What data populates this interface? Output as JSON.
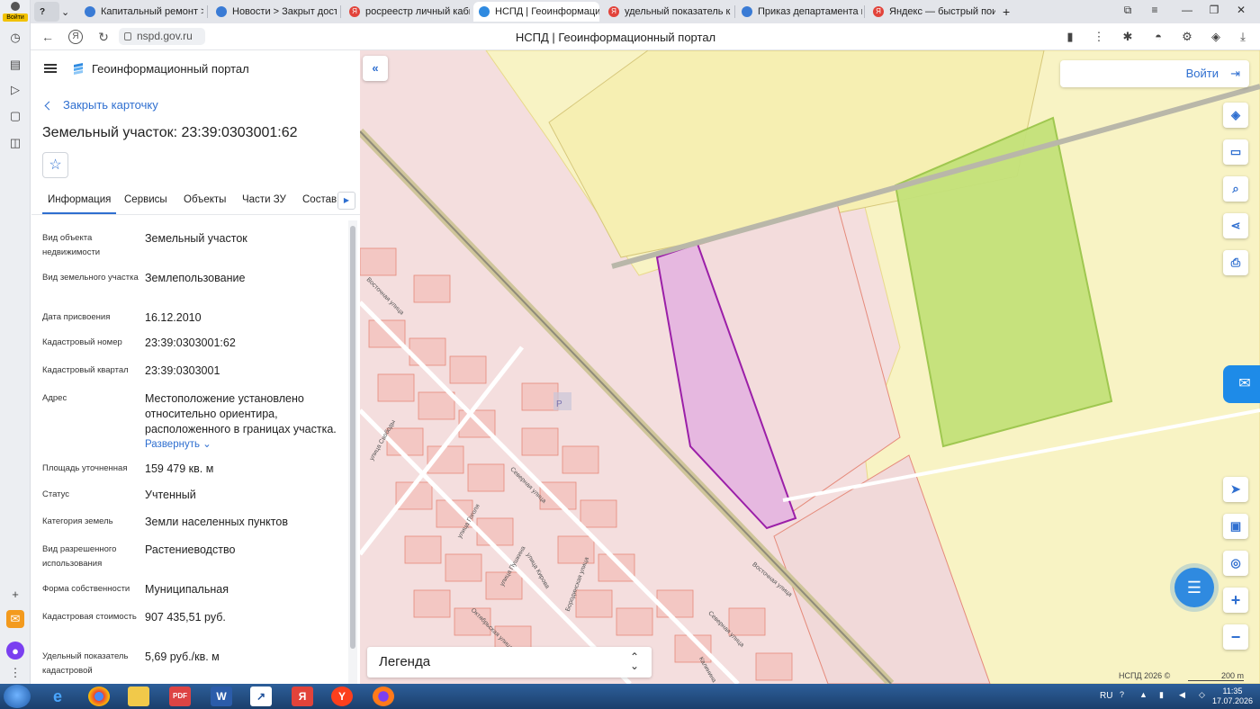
{
  "browser": {
    "user_badge": "Войти",
    "tabs": [
      {
        "label": "Капитальный ремонт > Г",
        "icon_color": "#3a7bd5"
      },
      {
        "label": "Новости > Закрыт доступ",
        "icon_color": "#3a7bd5"
      },
      {
        "label": "росреестр личный кабин",
        "icon_color": "#e2433a"
      },
      {
        "label": "НСПД | Геоинформацио",
        "icon_color": "#2f8ae0"
      },
      {
        "label": "удельный показатель кад",
        "icon_color": "#e2433a"
      },
      {
        "label": "Приказ департамента им",
        "icon_color": "#3a7bd5"
      },
      {
        "label": "Яндекс — быстрый поиск",
        "icon_color": "#e2433a"
      }
    ],
    "url": "nspd.gov.ru",
    "page_title": "НСПД | Геоинформационный портал"
  },
  "panel": {
    "app_name": "Геоинформационный портал",
    "close_card": "Закрыть карточку",
    "card_title": "Земельный участок: 23:39:0303001:62",
    "tabs": [
      "Информация",
      "Сервисы",
      "Объекты",
      "Части ЗУ",
      "Состав"
    ],
    "rows": [
      {
        "key": "Вид объекта недвижимости",
        "value": "Земельный участок"
      },
      {
        "key": "Вид земельного участка",
        "value": "Землепользование"
      },
      {
        "key": "Дата присвоения",
        "value": "16.12.2010"
      },
      {
        "key": "Кадастровый номер",
        "value": "23:39:0303001:62"
      },
      {
        "key": "Кадастровый квартал",
        "value": "23:39:0303001"
      },
      {
        "key": "Адрес",
        "value": "Местоположение установлено относительно ориентира, расположенного в границах участка."
      },
      {
        "key": "Площадь уточненная",
        "value": "159 479 кв. м"
      },
      {
        "key": "Статус",
        "value": "Учтенный"
      },
      {
        "key": "Категория земель",
        "value": "Земли населенных пунктов"
      },
      {
        "key": "Вид разрешенного использования",
        "value": "Растениеводство"
      },
      {
        "key": "Форма собственности",
        "value": "Муниципальная"
      },
      {
        "key": "Кадастровая стоимость",
        "value": "907 435,51 руб."
      },
      {
        "key": "Удельный показатель кадастровой",
        "value": "5,69 руб./кв. м"
      }
    ],
    "expand_label": "Развернуть"
  },
  "map": {
    "login_label": "Войти",
    "legend_label": "Легенда",
    "copyright": "НСПД 2026 ©",
    "scale_label": "200 m",
    "streets": [
      "Восточная улица",
      "улица Свободы",
      "Северная улица",
      "улица Гоголя",
      "улица Пушкина",
      "улица Кирова",
      "Бородинская улица",
      "Октябрьская улица",
      "Восточная улица",
      "Северная улица",
      "Калинина"
    ],
    "parking_label": "P",
    "colors": {
      "parcel_selected": "#e6b8e0",
      "parcel_border": "#9b1fa8",
      "field_green": "#c4e27a",
      "yellow_zone": "#f8f3c4",
      "pink_zone": "#f4dede"
    }
  },
  "taskbar": {
    "lang": "RU",
    "time": "11:35",
    "date": "17.07.2026"
  }
}
